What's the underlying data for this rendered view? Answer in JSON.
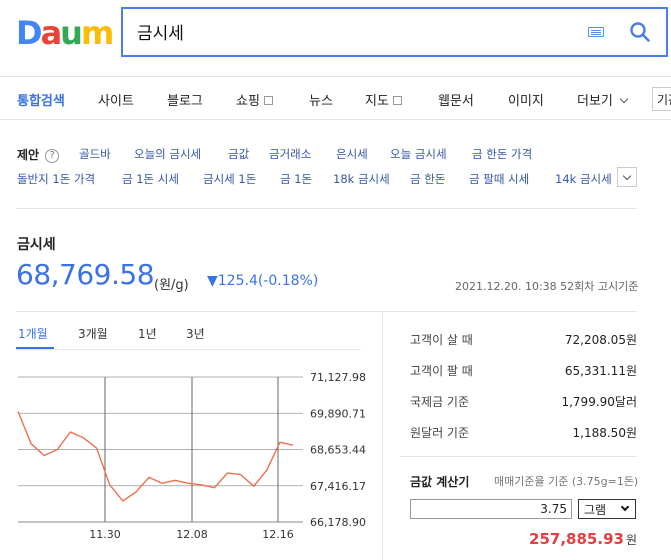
{
  "logo": {
    "letters": [
      "D",
      "a",
      "u",
      "m"
    ],
    "colors": [
      "#4285f4",
      "#ea4335",
      "#34a853",
      "#fbbc05"
    ]
  },
  "search": {
    "value": "금시세"
  },
  "tabs": [
    {
      "label": "통합검색",
      "active": true
    },
    {
      "label": "사이트"
    },
    {
      "label": "블로그"
    },
    {
      "label": "쇼핑"
    },
    {
      "label": "뉴스"
    },
    {
      "label": "지도"
    },
    {
      "label": "웹문서"
    },
    {
      "label": "이미지"
    },
    {
      "label": "더보기"
    },
    {
      "label": "기간"
    }
  ],
  "suggestions": {
    "label": "제안",
    "help": "?",
    "row1": [
      "골드바",
      "오늘의 금시세",
      "금값",
      "금거래소",
      "은시세",
      "오늘 금시세",
      "금 한돈 가격"
    ],
    "row2": [
      "돌반지 1돈 가격",
      "금 1돈 시세",
      "금시세 1돈",
      "금 1돈",
      "18k 금시세",
      "금 한돈",
      "금 팔때 시세",
      "14k 금시세"
    ]
  },
  "gold": {
    "title": "금시세",
    "price": "68,769.58",
    "unit": "(원/g)",
    "change": "▼125.4(-0.18%)",
    "timestamp": "2021.12.20. 10:38 52회차 고시기준"
  },
  "period_tabs": [
    "1개월",
    "3개월",
    "1년",
    "3년"
  ],
  "chart_data": {
    "type": "line",
    "yticks": [
      "71,127.98",
      "69,890.71",
      "68,653.44",
      "67,416.17",
      "66,178.90"
    ],
    "ylim": [
      66178.9,
      71127.98
    ],
    "xticks": [
      "11.30",
      "12.08",
      "12.16"
    ],
    "color": "#f07050",
    "values": [
      69950,
      68850,
      68450,
      68650,
      69250,
      69050,
      68700,
      67450,
      66900,
      67200,
      67700,
      67500,
      67600,
      67500,
      67450,
      67350,
      67850,
      67800,
      67400,
      67950,
      68900,
      68800
    ]
  },
  "info": [
    {
      "label": "고객이 살 때",
      "value": "72,208.05원"
    },
    {
      "label": "고객이 팔 때",
      "value": "65,331.11원"
    },
    {
      "label": "국제금 기준",
      "value": "1,799.90달러"
    },
    {
      "label": "원달러 기준",
      "value": "1,188.50원"
    }
  ],
  "calc": {
    "title": "금값 계산기",
    "note": "매매기준율 기준 (3.75g=1돈)",
    "input": "3.75",
    "unit": "그램",
    "result": "257,885.93",
    "result_unit": "원"
  }
}
